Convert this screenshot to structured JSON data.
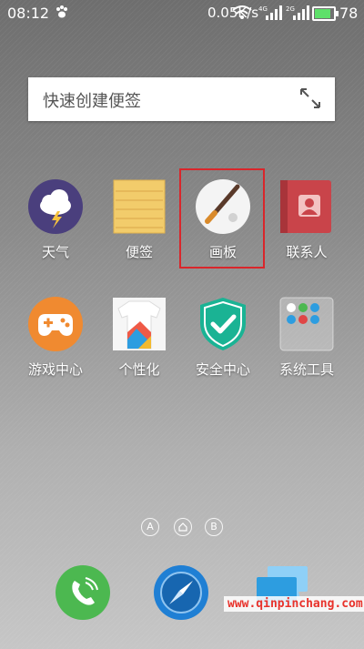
{
  "status_bar": {
    "time": "08:12",
    "network_speed": "0.05K/s",
    "signal_1_label": "4G",
    "signal_2_label": "2G",
    "battery_level": "78"
  },
  "quick_note": {
    "placeholder": "快速创建便签"
  },
  "apps": [
    {
      "label": "天气"
    },
    {
      "label": "便签"
    },
    {
      "label": "画板"
    },
    {
      "label": "联系人"
    },
    {
      "label": "游戏中心"
    },
    {
      "label": "个性化"
    },
    {
      "label": "安全中心"
    },
    {
      "label": "系统工具"
    }
  ],
  "pager": {
    "left": "A",
    "right": "B"
  },
  "watermark": "www.qinpinchang.com",
  "colors": {
    "weather_bg": "#4a3f7d",
    "notes_bg": "#f2cc6b",
    "contacts_bg": "#c9444a",
    "game_bg": "#f08a30",
    "security_bg": "#1ab394",
    "phone_bg": "#4cb850",
    "browser_bg": "#1f7fd4",
    "highlight": "#d9262b"
  }
}
